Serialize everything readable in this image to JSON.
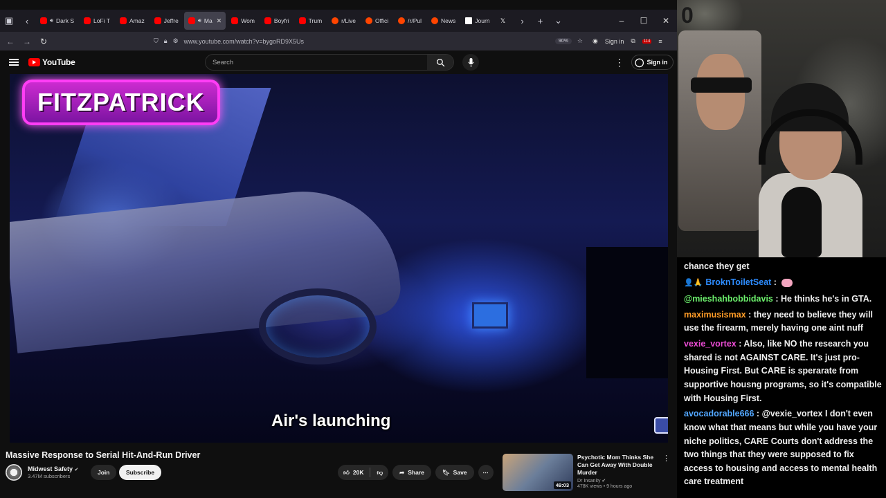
{
  "browser": {
    "tabs": [
      {
        "label": "Dark S",
        "icon": "youtube-icon",
        "audio": true,
        "active": false
      },
      {
        "label": "LoFi T",
        "icon": "youtube-icon",
        "audio": false,
        "active": false
      },
      {
        "label": "Amaz",
        "icon": "youtube-icon",
        "audio": false,
        "active": false
      },
      {
        "label": "Jeffre",
        "icon": "youtube-icon",
        "audio": false,
        "active": false
      },
      {
        "label": "Ma",
        "icon": "youtube-icon",
        "audio": true,
        "active": true
      },
      {
        "label": "Wom",
        "icon": "youtube-icon",
        "audio": false,
        "active": false
      },
      {
        "label": "Boyfri",
        "icon": "youtube-icon",
        "audio": false,
        "active": false
      },
      {
        "label": "Trum",
        "icon": "youtube-icon",
        "audio": false,
        "active": false
      },
      {
        "label": "r/Live",
        "icon": "reddit-icon",
        "audio": false,
        "active": false
      },
      {
        "label": "Offici",
        "icon": "reddit-icon",
        "audio": false,
        "active": false
      },
      {
        "label": "/r/Pul",
        "icon": "reddit-icon",
        "audio": false,
        "active": false
      },
      {
        "label": "News",
        "icon": "reddit-icon",
        "audio": false,
        "active": false
      },
      {
        "label": "Journ",
        "icon": "ap-icon",
        "audio": false,
        "active": false
      },
      {
        "label": "",
        "icon": "x-icon",
        "audio": false,
        "active": false
      }
    ],
    "url": "www.youtube.com/watch?v=bygoRD9X5Us",
    "zoom": "90%",
    "signin_label": "Sign in",
    "notif_count": "114"
  },
  "youtube": {
    "logo_text": "YouTube",
    "search_placeholder": "Search",
    "signin_label": "Sign in",
    "video": {
      "overlay_name": "FITZPATRICK",
      "caption": "Air's launching",
      "title": "Massive Response to Serial Hit-And-Run Driver",
      "channel": "Midwest Safety",
      "subscribers": "3.47M subscribers",
      "join_label": "Join",
      "subscribe_label": "Subscribe",
      "likes": "20K",
      "share_label": "Share",
      "save_label": "Save"
    },
    "recommended": {
      "title": "Psychotic Mom Thinks She Can Get Away With Double Murder",
      "channel": "Dr Insanity",
      "meta": "478K views • 9 hours ago",
      "duration": "49:03"
    }
  },
  "chat": {
    "messages": [
      {
        "user": "",
        "text": "chance they get",
        "class": "",
        "badges": ""
      },
      {
        "user": "BroknToiletSeat",
        "text": "",
        "class": "u-brokn",
        "badges": "👤🙏",
        "emote": true
      },
      {
        "user": "@mieshahbobbidavis",
        "text": "He thinks he's in GTA.",
        "class": "u-mies",
        "badges": ""
      },
      {
        "user": "maximusismax",
        "text": "they need to believe they will use the firearm, merely having one aint nuff",
        "class": "u-maxi",
        "badges": ""
      },
      {
        "user": "vexie_vortex",
        "text": "Also, like NO the research you shared is not AGAINST CARE. It's just pro-Housing First. But CARE is sperarate from supportive housng programs, so it's compatible with Housing First.",
        "class": "u-vexie",
        "badges": ""
      },
      {
        "user": "avocadorable666",
        "text": "@vexie_vortex I don't even know what that means but while you have your niche politics, CARE Courts don't address the two things that they were supposed to fix access to housing and access to mental health care treatment",
        "class": "u-avo",
        "badges": ""
      }
    ]
  },
  "webcam": {
    "wall_text": "0"
  }
}
